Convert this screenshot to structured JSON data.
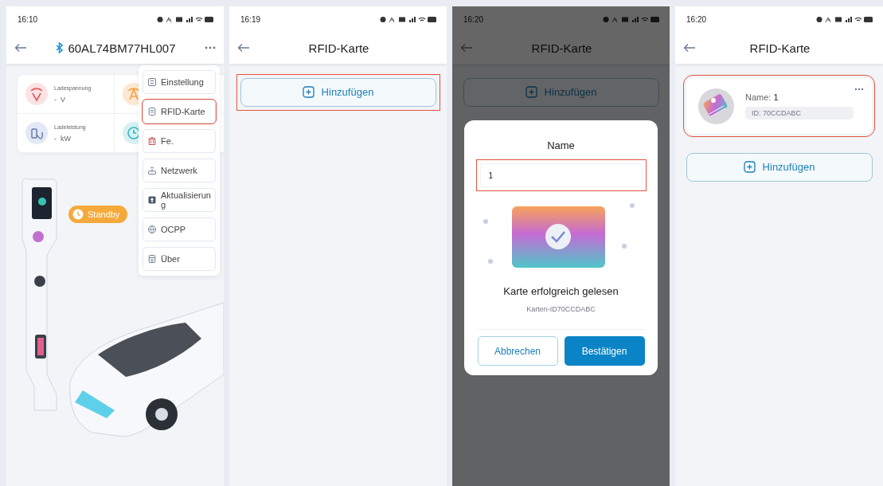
{
  "screens": [
    {
      "kind": "device",
      "status_time": "16:10",
      "title": "60AL74BM77HL007",
      "stats": [
        {
          "label": "Ladespannung",
          "value": "-",
          "unit": "V"
        },
        {
          "label": "Ladeleistung",
          "value": "-",
          "unit": "kW"
        }
      ],
      "status_badge": "Standby",
      "menu": [
        {
          "label": "Einstellung",
          "highlighted": false
        },
        {
          "label": "RFID-Karte",
          "highlighted": true
        },
        {
          "label": "Fe.",
          "highlighted": false
        },
        {
          "label": "Netzwerk",
          "highlighted": false
        },
        {
          "label": "Aktualisierung",
          "highlighted": false
        },
        {
          "label": "OCPP",
          "highlighted": false
        },
        {
          "label": "Über",
          "highlighted": false
        }
      ]
    },
    {
      "kind": "list",
      "status_time": "16:19",
      "title": "RFID-Karte",
      "add_button": {
        "label": "Hinzufügen",
        "highlighted": true
      }
    },
    {
      "kind": "dialog",
      "status_time": "16:20",
      "title": "RFID-Karte",
      "add_button": {
        "label": "Hinzufügen",
        "highlighted": false
      },
      "dialog": {
        "title": "Name",
        "field": {
          "value": "1",
          "highlighted": true
        },
        "message": "Karte erfolgreich gelesen",
        "card_id": "Karten-ID70CCDABC",
        "buttons": [
          {
            "label": "Abbrechen",
            "kind": "secondary"
          },
          {
            "label": "Bestätigen",
            "kind": "primary"
          }
        ]
      }
    },
    {
      "kind": "list",
      "status_time": "16:20",
      "title": "RFID-Karte",
      "cards": [
        {
          "name_label": "Name:",
          "name": "1",
          "id": "ID: 70CCDABC",
          "highlighted": true
        }
      ],
      "add_button": {
        "label": "Hinzufügen",
        "highlighted": false
      }
    }
  ]
}
